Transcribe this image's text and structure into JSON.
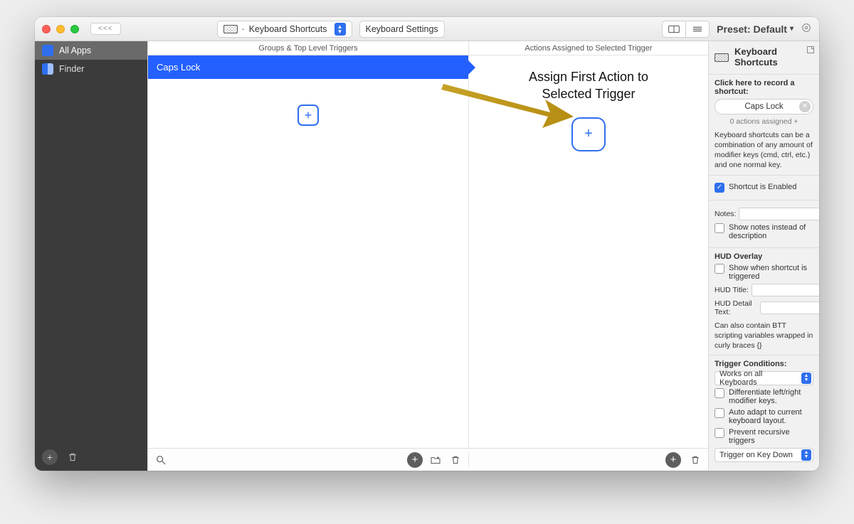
{
  "toolbar": {
    "back_label": "<<<",
    "tab_dropdown": "Keyboard Shortcuts",
    "tab_divider": "·",
    "settings_label": "Keyboard Settings",
    "preset_label": "Preset: Default",
    "preset_caret": "▾"
  },
  "sidebar": {
    "items": [
      {
        "label": "All Apps",
        "selected": true
      },
      {
        "label": "Finder",
        "selected": false
      }
    ]
  },
  "panels": {
    "groups_header": "Groups & Top Level Triggers",
    "actions_header": "Actions Assigned to Selected Trigger",
    "selected_trigger": "Caps Lock",
    "assign_line1": "Assign First Action to",
    "assign_line2": "Selected Trigger"
  },
  "inspector": {
    "title": "Keyboard Shortcuts",
    "record_prompt": "Click here to record a shortcut:",
    "shortcut_value": "Caps Lock",
    "actions_assigned": "0 actions assigned +",
    "help_text": "Keyboard shortcuts can be a combination of any amount of modifier keys (cmd, ctrl, etc.) and one normal key.",
    "enabled_label": "Shortcut is Enabled",
    "notes_label": "Notes:",
    "notes_checkbox": "Show notes instead of description",
    "hud_section": "HUD Overlay",
    "hud_show_label": "Show when shortcut is triggered",
    "hud_title_label": "HUD Title:",
    "hud_detail_label": "HUD Detail Text:",
    "hud_help": "Can also contain BTT scripting variables wrapped in curly braces {}",
    "cond_section": "Trigger Conditions:",
    "cond_select": "Works on all Keyboards",
    "cond_diff": "Differentiate left/right modifier keys.",
    "cond_auto": "Auto adapt to current keyboard layout.",
    "cond_recursive": "Prevent recursive triggers",
    "cond_key_select": "Trigger on Key Down"
  }
}
